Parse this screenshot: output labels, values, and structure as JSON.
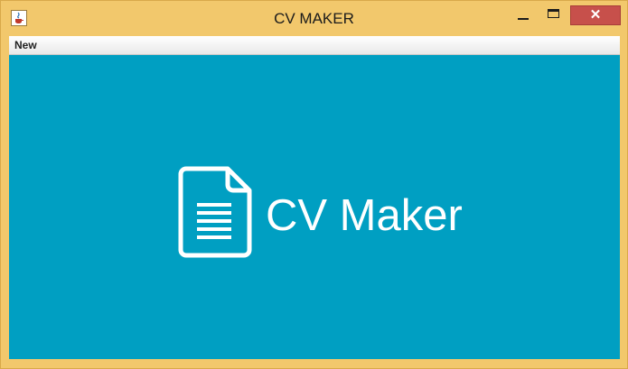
{
  "window": {
    "title": "CV MAKER",
    "close_glyph": "✕",
    "icons": {
      "app": "java-cup-icon",
      "minimize": "minimize-icon",
      "maximize": "maximize-icon",
      "close": "close-icon"
    }
  },
  "menubar": {
    "items": [
      {
        "label": "New"
      }
    ]
  },
  "splash": {
    "logo_text": "CV Maker",
    "icon": "document-icon",
    "background_color": "#009fc2",
    "foreground_color": "#ffffff"
  }
}
